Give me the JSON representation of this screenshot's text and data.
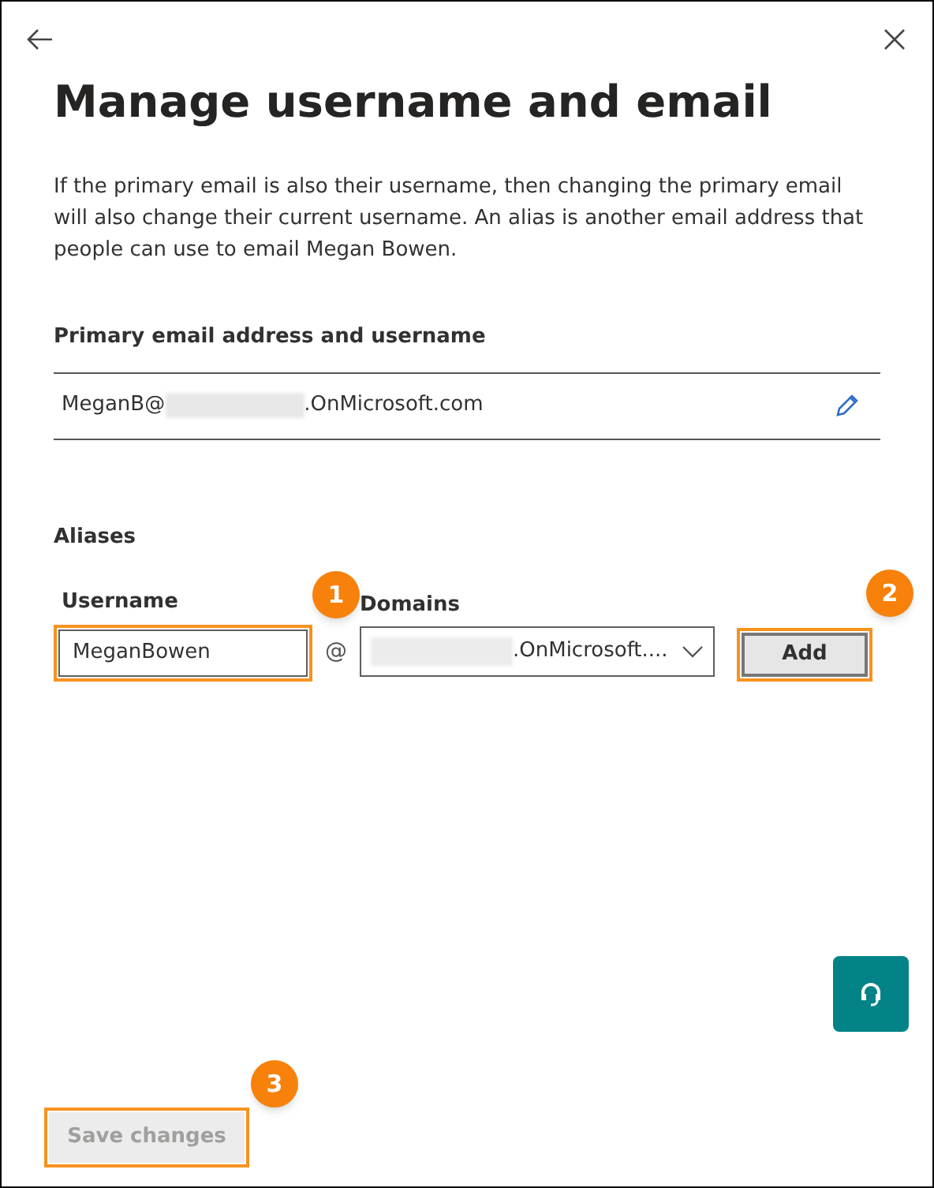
{
  "panel": {
    "title": "Manage username and email",
    "description": "If the primary email is also their username, then changing the primary email will also change their current username. An alias is another email address that people can use to email Megan Bowen."
  },
  "primary": {
    "heading": "Primary email address and username",
    "email_prefix": "MeganB@",
    "email_suffix": ".OnMicrosoft.com"
  },
  "aliases": {
    "heading": "Aliases",
    "username_label": "Username",
    "username_value": "MeganBowen",
    "at": "@",
    "domains_label": "Domains",
    "domain_suffix": ".OnMicrosoft....",
    "add_button": "Add"
  },
  "callouts": [
    "1",
    "2",
    "3"
  ],
  "save_button": {
    "label": "Save changes",
    "disabled": true
  }
}
